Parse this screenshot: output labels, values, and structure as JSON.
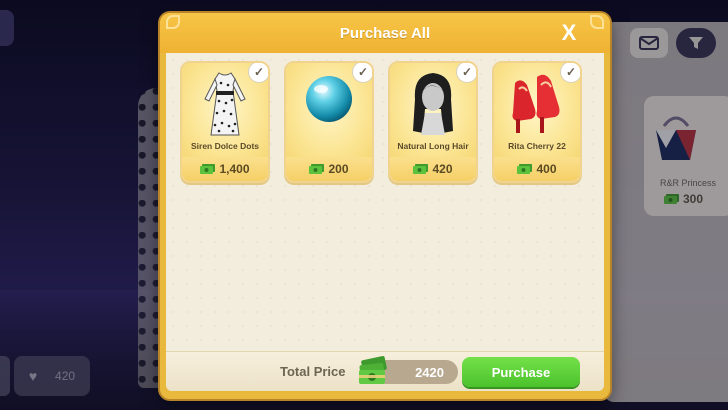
{
  "modal": {
    "title": "Purchase All",
    "close_label": "X",
    "items": [
      {
        "name": "Siren Dolce Dots",
        "price": "1,400",
        "icon": "dress-icon"
      },
      {
        "name": "",
        "price": "200",
        "icon": "pearl-icon"
      },
      {
        "name": "Natural Long Hair",
        "price": "420",
        "icon": "hair-icon"
      },
      {
        "name": "Rita Cherry 22",
        "price": "400",
        "icon": "red-heels-icon"
      }
    ],
    "check_mark": "✓",
    "footer": {
      "total_label": "Total Price",
      "total_value": "2420",
      "purchase_label": "Purchase"
    }
  },
  "background": {
    "like_count": "420",
    "side_item": {
      "name": "R&R Princess",
      "price": "300"
    }
  }
}
